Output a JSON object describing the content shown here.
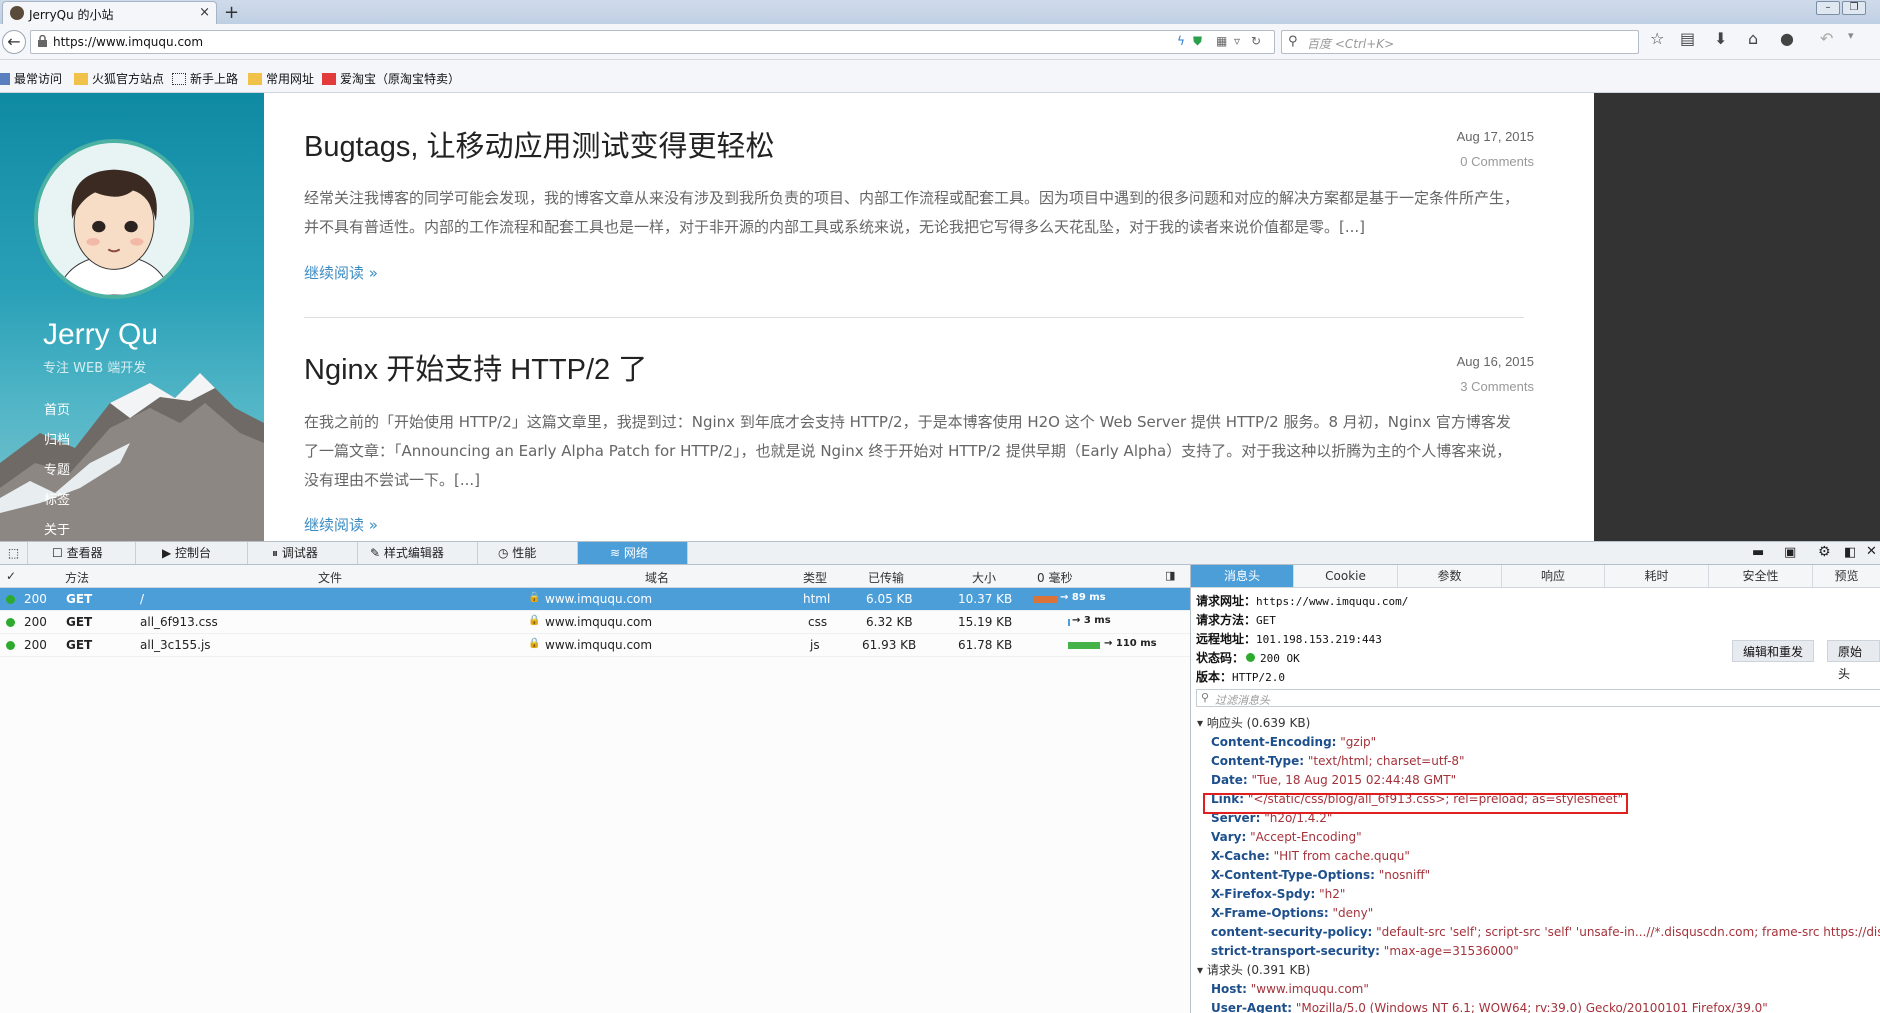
{
  "browser": {
    "tab_title": "JerryQu 的小站",
    "tab_close": "×",
    "new_tab": "+",
    "url": "https://www.imququ.com",
    "search_placeholder": "百度 <Ctrl+K>",
    "bookmarks": [
      "最常访问",
      "火狐官方站点",
      "新手上路",
      "常用网址",
      "爱淘宝（原淘宝特卖）"
    ]
  },
  "sidebar": {
    "name": "Jerry Qu",
    "tagline": "专注 WEB 端开发",
    "nav": [
      "首页",
      "归档",
      "专题",
      "标签",
      "关于"
    ]
  },
  "posts": [
    {
      "title": "Bugtags, 让移动应用测试变得更轻松",
      "date": "Aug 17, 2015",
      "comments": "0 Comments",
      "body": "经常关注我博客的同学可能会发现，我的博客文章从来没有涉及到我所负责的项目、内部工作流程或配套工具。因为项目中遇到的很多问题和对应的解决方案都是基于一定条件所产生，并不具有普适性。内部的工作流程和配套工具也是一样，对于非开源的内部工具或系统来说，无论我把它写得多么天花乱坠，对于我的读者来说价值都是零。[...]",
      "more": "继续阅读 »"
    },
    {
      "title": "Nginx 开始支持 HTTP/2 了",
      "date": "Aug 16, 2015",
      "comments": "3 Comments",
      "body": "在我之前的「开始使用 HTTP/2」这篇文章里，我提到过：Nginx 到年底才会支持 HTTP/2，于是本博客使用 H2O 这个 Web Server 提供 HTTP/2 服务。8 月初，Nginx 官方博客发了一篇文章：「Announcing an Early Alpha Patch for HTTP/2」，也就是说 Nginx 终于开始对 HTTP/2 提供早期（Early Alpha）支持了。对于我这种以折腾为主的个人博客来说，没有理由不尝试一下。[...]",
      "more": "继续阅读 »"
    }
  ],
  "devtools": {
    "tools": [
      "查看器",
      "控制台",
      "调试器",
      "样式编辑器",
      "性能",
      "网络"
    ],
    "columns": {
      "check": "✓",
      "method": "方法",
      "file": "文件",
      "domain": "域名",
      "type": "类型",
      "transferred": "已传输",
      "size": "大小",
      "timeline": "0 毫秒"
    },
    "requests": [
      {
        "status": "200",
        "method": "GET",
        "file": "/",
        "domain": "www.imququ.com",
        "type": "html",
        "transferred": "6.05 KB",
        "size": "10.37 KB",
        "time": "→ 89 ms",
        "bar_color": "#d9733a"
      },
      {
        "status": "200",
        "method": "GET",
        "file": "all_6f913.css",
        "domain": "www.imququ.com",
        "type": "css",
        "transferred": "6.32 KB",
        "size": "15.19 KB",
        "time": "→ 3 ms",
        "bar_color": "#4c9ed9"
      },
      {
        "status": "200",
        "method": "GET",
        "file": "all_3c155.js",
        "domain": "www.imququ.com",
        "type": "js",
        "transferred": "61.93 KB",
        "size": "61.78 KB",
        "time": "→ 110 ms",
        "bar_color": "#46b34a"
      }
    ],
    "detail_tabs": [
      "消息头",
      "Cookie",
      "参数",
      "响应",
      "耗时",
      "安全性",
      "预览"
    ],
    "summary": {
      "url_label": "请求网址：",
      "url": "https://www.imququ.com/",
      "method_label": "请求方法：",
      "method": "GET",
      "remote_label": "远程地址：",
      "remote": "101.198.153.219:443",
      "status_label": "状态码：",
      "status": "200 OK",
      "version_label": "版本：",
      "version": "HTTP/2.0"
    },
    "buttons": {
      "edit_resend": "编辑和重发",
      "raw_headers": "原始头"
    },
    "filter_placeholder": "过滤消息头",
    "response_section": "响应头 (0.639 KB)",
    "response_headers": [
      {
        "k": "Content-Encoding:",
        "v": "\"gzip\""
      },
      {
        "k": "Content-Type:",
        "v": "\"text/html; charset=utf-8\""
      },
      {
        "k": "Date:",
        "v": "\"Tue, 18 Aug 2015 02:44:48 GMT\""
      },
      {
        "k": "Link:",
        "v": "\"</static/css/blog/all_6f913.css>; rel=preload; as=stylesheet\""
      },
      {
        "k": "Server:",
        "v": "\"h2o/1.4.2\""
      },
      {
        "k": "Vary:",
        "v": "\"Accept-Encoding\""
      },
      {
        "k": "X-Cache:",
        "v": "\"HIT from cache.ququ\""
      },
      {
        "k": "X-Content-Type-Options:",
        "v": "\"nosniff\""
      },
      {
        "k": "X-Firefox-Spdy:",
        "v": "\"h2\""
      },
      {
        "k": "X-Frame-Options:",
        "v": "\"deny\""
      },
      {
        "k": "content-security-policy:",
        "v": "\"default-src 'self'; script-src 'self' 'unsafe-in...//*.disquscdn.com; frame-src https://disqus.com\""
      },
      {
        "k": "strict-transport-security:",
        "v": "\"max-age=31536000\""
      }
    ],
    "request_section": "请求头 (0.391 KB)",
    "request_headers": [
      {
        "k": "Host:",
        "v": "\"www.imququ.com\""
      },
      {
        "k": "User-Agent:",
        "v": "\"Mozilla/5.0 (Windows NT 6.1; WOW64; rv:39.0) Gecko/20100101 Firefox/39.0\""
      }
    ]
  }
}
